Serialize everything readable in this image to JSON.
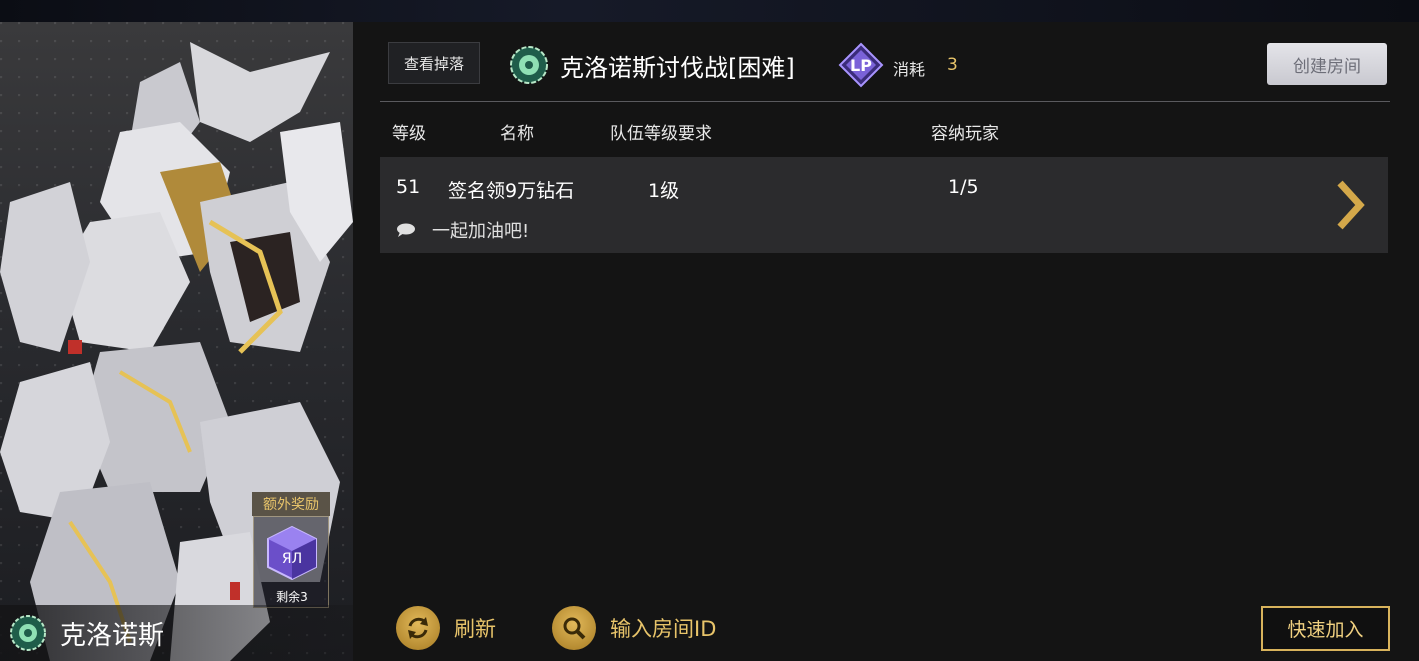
{
  "left_panel": {
    "boss_name": "克洛诺斯",
    "bonus": {
      "title": "额外奖励",
      "remaining": "剩余3"
    }
  },
  "header": {
    "view_drops": "查看掉落",
    "mission_title": "克洛诺斯讨伐战[困难]",
    "cost_label": "消耗",
    "cost_value": "3",
    "create_room": "创建房间"
  },
  "table": {
    "columns": [
      "等级",
      "名称",
      "队伍等级要求",
      "容纳玩家"
    ],
    "rows": [
      {
        "level": "51",
        "name": "签名领9万钻石",
        "team_level": "1级",
        "players": "1/5",
        "message": "一起加油吧!"
      }
    ]
  },
  "footer": {
    "refresh": "刷新",
    "enter_room_id": "输入房间ID",
    "quick_join": "快速加入"
  },
  "colors": {
    "accent_gold": "#e8c46a",
    "panel_bg": "#141414",
    "row_bg": "#2b2b2d"
  }
}
